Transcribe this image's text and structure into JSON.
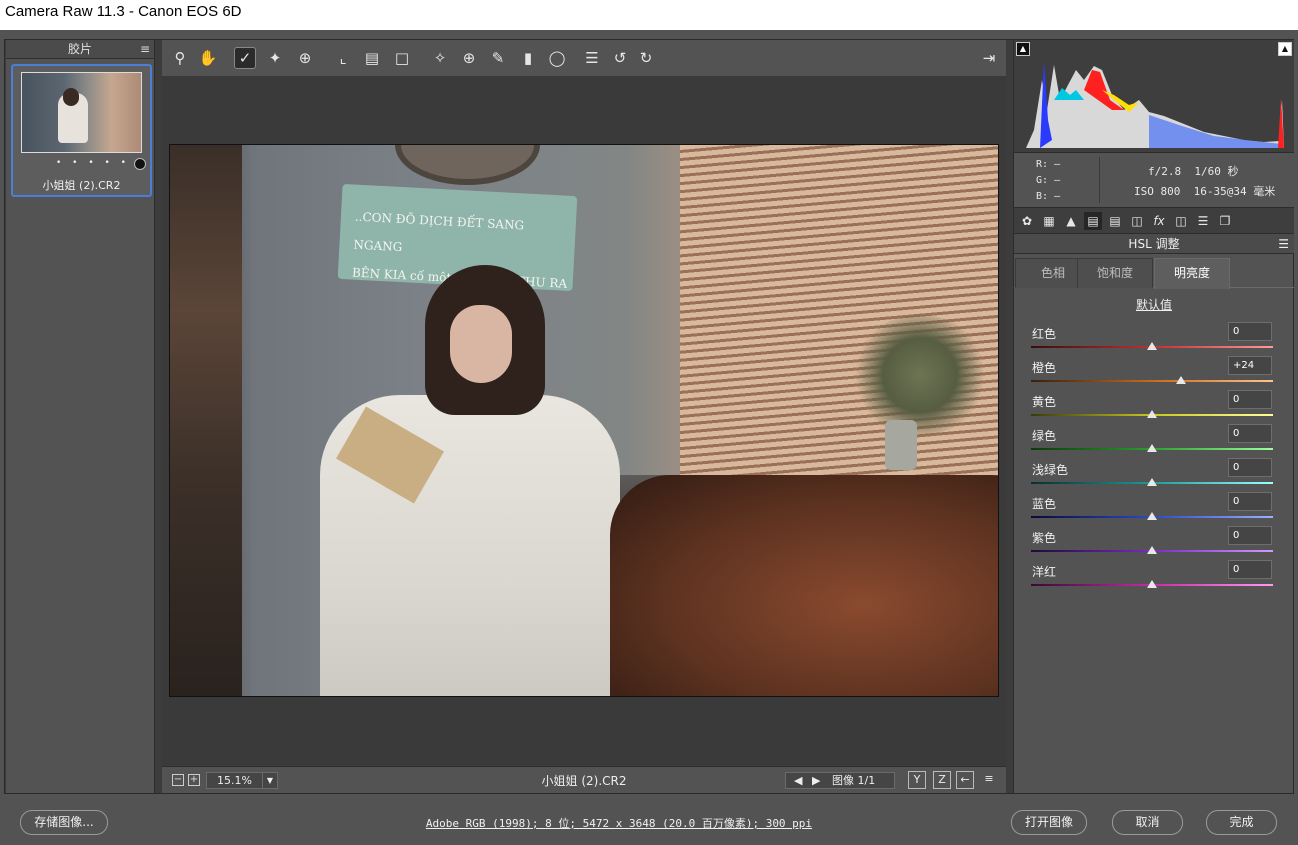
{
  "window": {
    "title": "Camera Raw 11.3 -  Canon EOS 6D"
  },
  "filmstrip": {
    "header": "胶片",
    "menu_icon": "≡",
    "thumb_name": "小姐姐 (2).CR2",
    "rating_dots": "• • • • •"
  },
  "toolbar": {
    "tools": [
      "zoom-icon",
      "hand-icon",
      "white-balance-icon",
      "color-sampler-icon",
      "target-adjust-icon",
      "crop-icon",
      "straighten-icon",
      "transform-icon",
      "spot-removal-icon",
      "red-eye-icon",
      "adjustment-brush-icon",
      "graduated-filter-icon",
      "radial-filter-icon",
      "preferences-icon",
      "rotate-left-icon",
      "rotate-right-icon"
    ],
    "active_tool": "white-balance-icon"
  },
  "canvas": {
    "sign_line1": "..CON ĐÕ DỊCH ĐẾT SANG NGANG",
    "sign_line2": "BÊN KIA cố một cái LÀNG THU RA"
  },
  "canvas_bar": {
    "zoom_minus": "−",
    "zoom_plus": "+",
    "zoom": "15.1%",
    "filename": "小姐姐 (2).CR2",
    "prev": "◀",
    "next": "▶",
    "image_counter": "图像 1/1",
    "icons": [
      "Y",
      "Z",
      "←",
      "≡"
    ]
  },
  "right_panel": {
    "rgb": {
      "r": "R:",
      "g": "G:",
      "b": "B:",
      "dash": "—"
    },
    "exif": {
      "aperture": "f/2.8",
      "shutter": "1/60 秒",
      "iso": "ISO 800",
      "lens": "16-35@34 毫米"
    },
    "panel_title": "HSL 调整",
    "subtabs": [
      "色相",
      "饱和度",
      "明亮度"
    ],
    "active_subtab": 2,
    "defaults_link": "默认值",
    "sliders": [
      {
        "label": "红色",
        "value": "0",
        "pct": 0.5,
        "gradient": "linear-gradient(90deg,#3a0d0d,#c23030,#ff9a9a)"
      },
      {
        "label": "橙色",
        "value": "+24",
        "pct": 0.62,
        "gradient": "linear-gradient(90deg,#3a200a,#c86a1e,#ffc38a)"
      },
      {
        "label": "黄色",
        "value": "0",
        "pct": 0.5,
        "gradient": "linear-gradient(90deg,#3a3a0a,#c8c81e,#ffff9a)"
      },
      {
        "label": "绿色",
        "value": "0",
        "pct": 0.5,
        "gradient": "linear-gradient(90deg,#0a3a0a,#2aa02a,#9aff9a)"
      },
      {
        "label": "浅绿色",
        "value": "0",
        "pct": 0.5,
        "gradient": "linear-gradient(90deg,#0a3030,#1e9a9a,#9affff)"
      },
      {
        "label": "蓝色",
        "value": "0",
        "pct": 0.5,
        "gradient": "linear-gradient(90deg,#0a0a3a,#2a4ac8,#9ab0ff)"
      },
      {
        "label": "紫色",
        "value": "0",
        "pct": 0.5,
        "gradient": "linear-gradient(90deg,#200a3a,#7a2ac8,#d09aff)"
      },
      {
        "label": "洋红",
        "value": "0",
        "pct": 0.5,
        "gradient": "linear-gradient(90deg,#3a0a30,#c82aa8,#ff9af0)"
      }
    ]
  },
  "footer": {
    "save": "存储图像...",
    "info": "Adobe RGB (1998); 8 位; 5472 x 3648 (20.0 百万像素); 300 ppi",
    "open": "打开图像",
    "cancel": "取消",
    "done": "完成"
  }
}
